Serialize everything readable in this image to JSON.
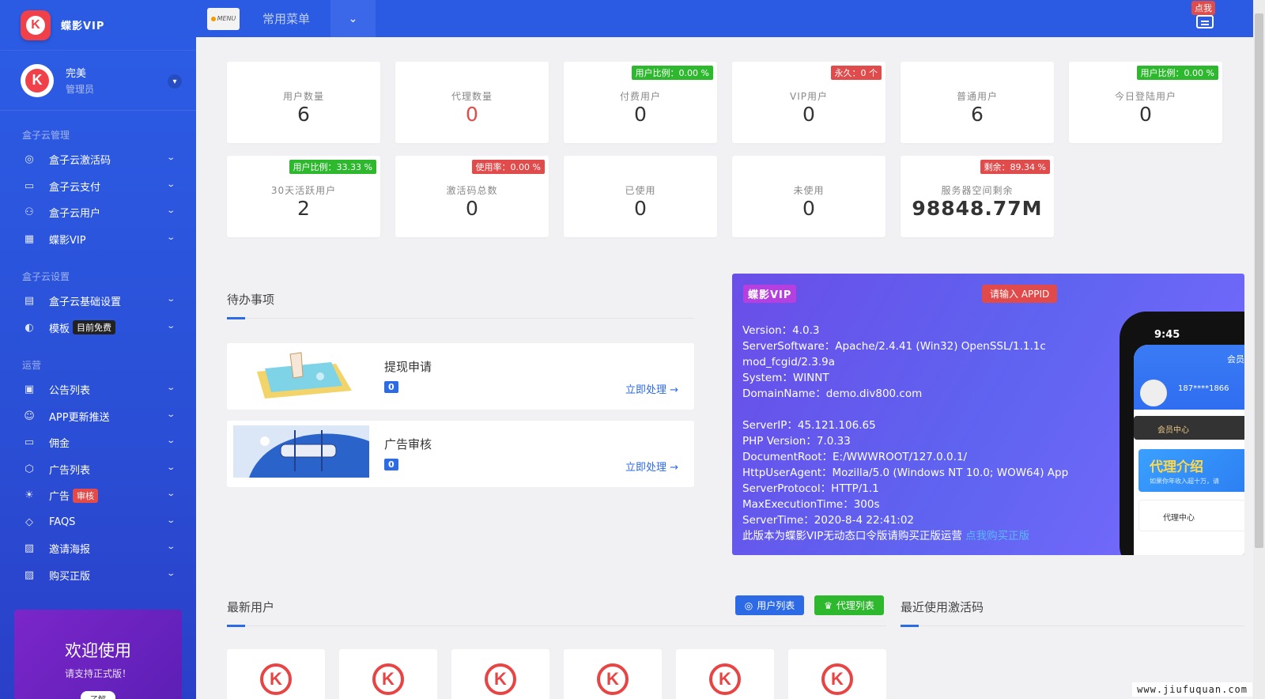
{
  "brand": {
    "name": "蝶影VIP",
    "logo_letter": "K"
  },
  "user": {
    "name": "完美",
    "role": "管理员"
  },
  "sidebar": {
    "sections": [
      {
        "title": "盒子云管理",
        "items": [
          {
            "label": "盒子云激活码",
            "icon": "fingerprint-icon"
          },
          {
            "label": "盒子云支付",
            "icon": "wallet-icon"
          },
          {
            "label": "盒子云用户",
            "icon": "users-icon"
          },
          {
            "label": "蝶影VIP",
            "icon": "film-icon"
          }
        ]
      },
      {
        "title": "盒子云设置",
        "items": [
          {
            "label": "盒子云基础设置",
            "icon": "layout-icon"
          },
          {
            "label": "模板",
            "icon": "palette-icon",
            "tag": "目前免费"
          }
        ]
      },
      {
        "title": "运营",
        "items": [
          {
            "label": "公告列表",
            "icon": "notice-icon"
          },
          {
            "label": "APP更新推送",
            "icon": "robot-icon"
          },
          {
            "label": "佣金",
            "icon": "wallet-icon"
          },
          {
            "label": "广告列表",
            "icon": "box-icon"
          },
          {
            "label": "广告",
            "icon": "bulb-icon",
            "tag": "审核"
          },
          {
            "label": "FAQS",
            "icon": "tag-icon"
          },
          {
            "label": "邀请海报",
            "icon": "image-icon"
          },
          {
            "label": "购买正版",
            "icon": "image-icon"
          }
        ]
      }
    ]
  },
  "welcome": {
    "title": "欢迎使用",
    "subtitle": "请支持正式版！",
    "button": "了解"
  },
  "topbar": {
    "menu_badge": "MENU",
    "menu_label": "常用菜单",
    "notify_badge": "点我"
  },
  "stats_row1": [
    {
      "label": "用户数量",
      "value": "6"
    },
    {
      "label": "代理数量",
      "value": "0",
      "red": true
    },
    {
      "label": "付费用户",
      "value": "0",
      "badge": "用户比例：0.00 %",
      "badge_color": "green"
    },
    {
      "label": "VIP用户",
      "value": "0",
      "badge": "永久：0 个",
      "badge_color": "red"
    },
    {
      "label": "普通用户",
      "value": "6"
    },
    {
      "label": "今日登陆用户",
      "value": "0",
      "badge": "用户比例：0.00 %",
      "badge_color": "green"
    }
  ],
  "stats_row2": [
    {
      "label": "30天活跃用户",
      "value": "2",
      "badge": "用户比例：33.33 %",
      "badge_color": "green"
    },
    {
      "label": "激活码总数",
      "value": "0",
      "badge": "使用率：0.00 %",
      "badge_color": "red"
    },
    {
      "label": "已使用",
      "value": "0"
    },
    {
      "label": "未使用",
      "value": "0"
    },
    {
      "label": "服务器空间剩余",
      "value": "98848.77M",
      "badge": "剩余：89.34 %",
      "badge_color": "red",
      "big": true
    }
  ],
  "todo": {
    "title": "待办事项",
    "items": [
      {
        "title": "提现申请",
        "count": "0",
        "action": "立即处理 →"
      },
      {
        "title": "广告审核",
        "count": "0",
        "action": "立即处理 →"
      }
    ]
  },
  "server": {
    "tag": "蝶影VIP",
    "appid_button": "请输入 APPID",
    "lines1": [
      "Version：4.0.3",
      "ServerSoftware：Apache/2.4.41 (Win32) OpenSSL/1.1.1c",
      "mod_fcgid/2.3.9a",
      "System：WINNT",
      "DomainName：demo.div800.com"
    ],
    "lines2": [
      "ServerIP：45.121.106.65",
      "PHP Version：7.0.33",
      "DocumentRoot：E:/WWWROOT/127.0.0.1/",
      "HttpUserAgent：Mozilla/5.0 (Windows NT 10.0; WOW64) App",
      "ServerProtocol：HTTP/1.1",
      "MaxExecutionTime：300s",
      "ServerTime：2020-8-4 22:41:02"
    ],
    "notice": "此版本为蝶影VIP无动态口令版请购买正版运营",
    "notice_link": "点我购买正版",
    "phone": {
      "time": "9:45",
      "header": "会员中心",
      "phone_num": "187****1866",
      "vip": "会员中心",
      "agent": "代理介绍",
      "agent_sub": "如果你年收入超十万，请",
      "center": "代理中心"
    }
  },
  "bottom": {
    "latest_users": "最新用户",
    "user_list_btn": "用户列表",
    "agent_list_btn": "代理列表",
    "recent_codes": "最近使用激活码",
    "user_cards": 6
  },
  "watermark": "www.jiufuquan.com"
}
